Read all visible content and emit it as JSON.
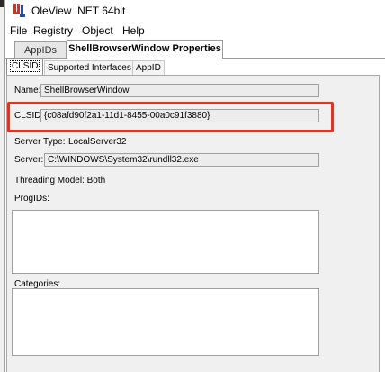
{
  "window": {
    "title": "OleView .NET 64bit"
  },
  "menubar": {
    "items": [
      "File",
      "Registry",
      "Object",
      "Help"
    ]
  },
  "document_tabs": [
    "AppIDs",
    "ShellBrowserWindow Properties"
  ],
  "inner_tabs": [
    "CLSID",
    "Supported Interfaces",
    "AppID"
  ],
  "clsid_page": {
    "name_label": "Name:",
    "name_value": "ShellBrowserWindow",
    "clsid_label": "CLSID:",
    "clsid_value": "{c08afd90f2a1-11d1-8455-00a0c91f3880}",
    "server_type_label": "Server Type:",
    "server_type_value": "LocalServer32",
    "server_label": "Server:",
    "server_value": "C:\\WINDOWS\\System32\\rundll32.exe",
    "threading_model": "Threading Model: Both",
    "progids_label": "ProgIDs:",
    "categories_label": "Categories:"
  },
  "colors": {
    "highlight": "#e8321e",
    "field_bg": "#ececec",
    "panel_bg": "#f0f0f0"
  }
}
